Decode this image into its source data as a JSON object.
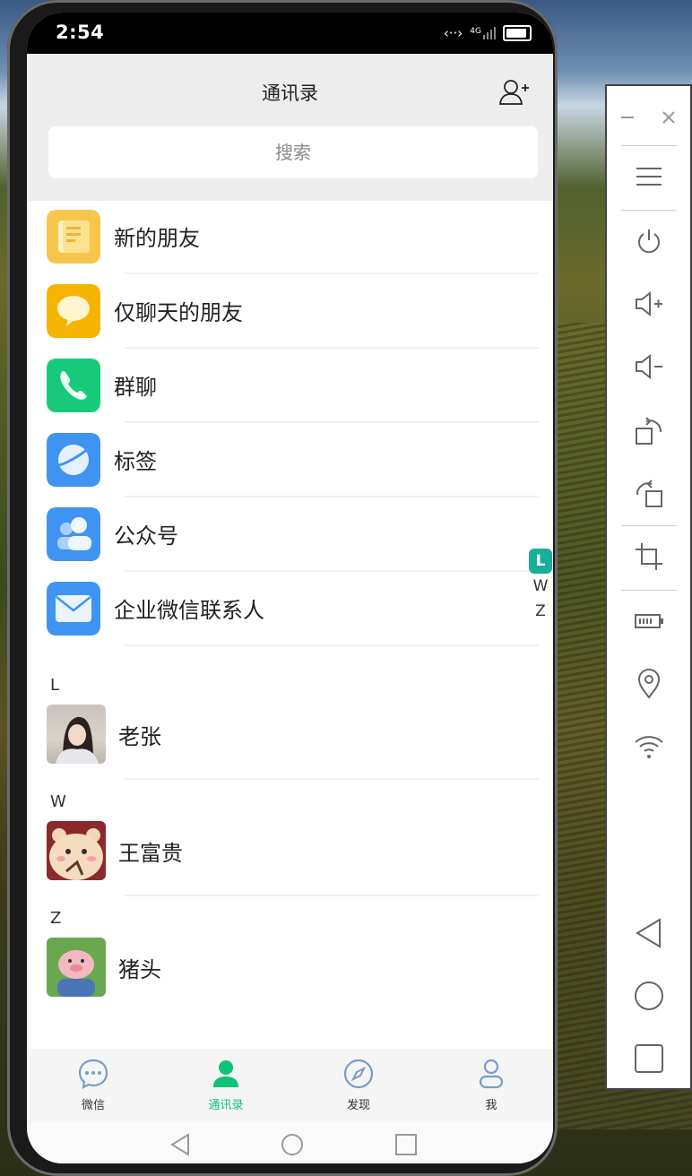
{
  "status_bar": {
    "time": "2:54",
    "network": "4G"
  },
  "header": {
    "title": "通讯录",
    "add_icon": "add-friend-icon"
  },
  "search": {
    "placeholder": "搜索"
  },
  "menu_items": [
    {
      "label": "新的朋友",
      "icon": "new-friends-icon",
      "color": "#f7c64c"
    },
    {
      "label": "仅聊天的朋友",
      "icon": "chat-only-icon",
      "color": "#f6b400"
    },
    {
      "label": "群聊",
      "icon": "group-chat-icon",
      "color": "#18c97a"
    },
    {
      "label": "标签",
      "icon": "tag-icon",
      "color": "#3f94f2"
    },
    {
      "label": "公众号",
      "icon": "official-account-icon",
      "color": "#3f94f2"
    },
    {
      "label": "企业微信联系人",
      "icon": "work-contacts-icon",
      "color": "#3f94f2"
    }
  ],
  "sections": [
    {
      "letter": "L",
      "contacts": [
        {
          "name": "老张"
        }
      ]
    },
    {
      "letter": "W",
      "contacts": [
        {
          "name": "王富贵"
        }
      ]
    },
    {
      "letter": "Z",
      "contacts": [
        {
          "name": "猪头"
        }
      ]
    }
  ],
  "index_bar": [
    "L",
    "W",
    "Z"
  ],
  "index_active": "L",
  "tabbar": {
    "tabs": [
      {
        "label": "微信",
        "icon": "chat-bubble-icon"
      },
      {
        "label": "通讯录",
        "icon": "contacts-icon"
      },
      {
        "label": "发现",
        "icon": "compass-icon"
      },
      {
        "label": "我",
        "icon": "profile-icon"
      }
    ],
    "active": "通讯录",
    "active_color": "#0fc27a"
  },
  "emulator_toolbar": {
    "buttons": [
      "minimize-icon",
      "close-icon",
      "menu-icon",
      "power-icon",
      "volume-up-icon",
      "volume-down-icon",
      "rotate-right-icon",
      "rotate-left-icon",
      "crop-icon",
      "battery-icon",
      "location-icon",
      "wifi-icon",
      "back-icon",
      "home-icon",
      "recents-icon"
    ]
  }
}
